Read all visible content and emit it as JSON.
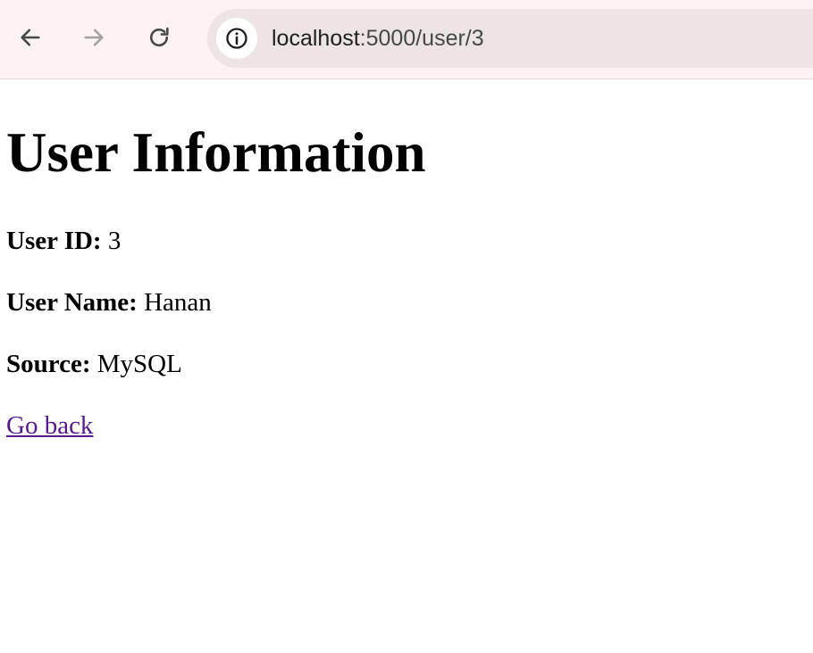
{
  "browser": {
    "url_host": "localhost",
    "url_path": ":5000/user/3",
    "icons": {
      "back": "arrow-left-icon",
      "forward": "arrow-right-icon",
      "reload": "reload-icon",
      "site_info": "info-icon"
    },
    "colors": {
      "toolbar_bg": "#fbf3f3",
      "omnibox_bg": "#ede4e6"
    }
  },
  "page": {
    "title": "User Information",
    "fields": {
      "user_id_label": "User ID:",
      "user_id_value": "3",
      "user_name_label": "User Name:",
      "user_name_value": "Hanan",
      "source_label": "Source:",
      "source_value": "MySQL"
    },
    "go_back_label": "Go back",
    "colors": {
      "visited_link": "#551a8b"
    }
  }
}
